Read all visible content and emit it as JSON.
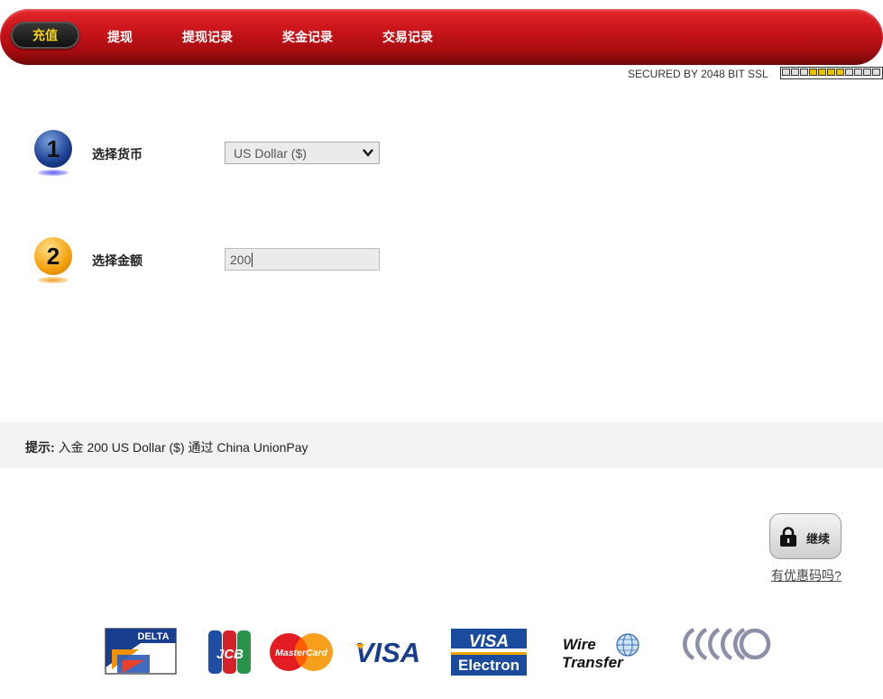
{
  "nav": {
    "items": [
      "充值",
      "提现",
      "提现记录",
      "奖金记录",
      "交易记录"
    ],
    "active_index": 0
  },
  "security": {
    "ssl_text": "SECURED BY 2048 BIT SSL",
    "meter_total": 11,
    "meter_filled": 4
  },
  "steps": [
    {
      "number": "1",
      "label": "选择货币"
    },
    {
      "number": "2",
      "label": "选择金额"
    }
  ],
  "currency": {
    "selected": "US Dollar ($)"
  },
  "amount": {
    "value": "200"
  },
  "hint": {
    "label": "提示:",
    "text": "入金 200 US Dollar ($) 通过 China UnionPay"
  },
  "continue_label": "继续",
  "coupon_link": "有优惠码吗?",
  "payment_logos": {
    "delta": "DELTA",
    "jcb": "JCB",
    "mastercard": "MasterCard",
    "visa": "VISA",
    "visa_electron_top": "VISA",
    "visa_electron_bottom": "Electron",
    "wire_top": "Wire",
    "wire_bottom": "Transfer"
  },
  "colors": {
    "nav_red": "#c8141a",
    "active_text": "#f4d21e",
    "visa_blue": "#1a3e8f"
  }
}
